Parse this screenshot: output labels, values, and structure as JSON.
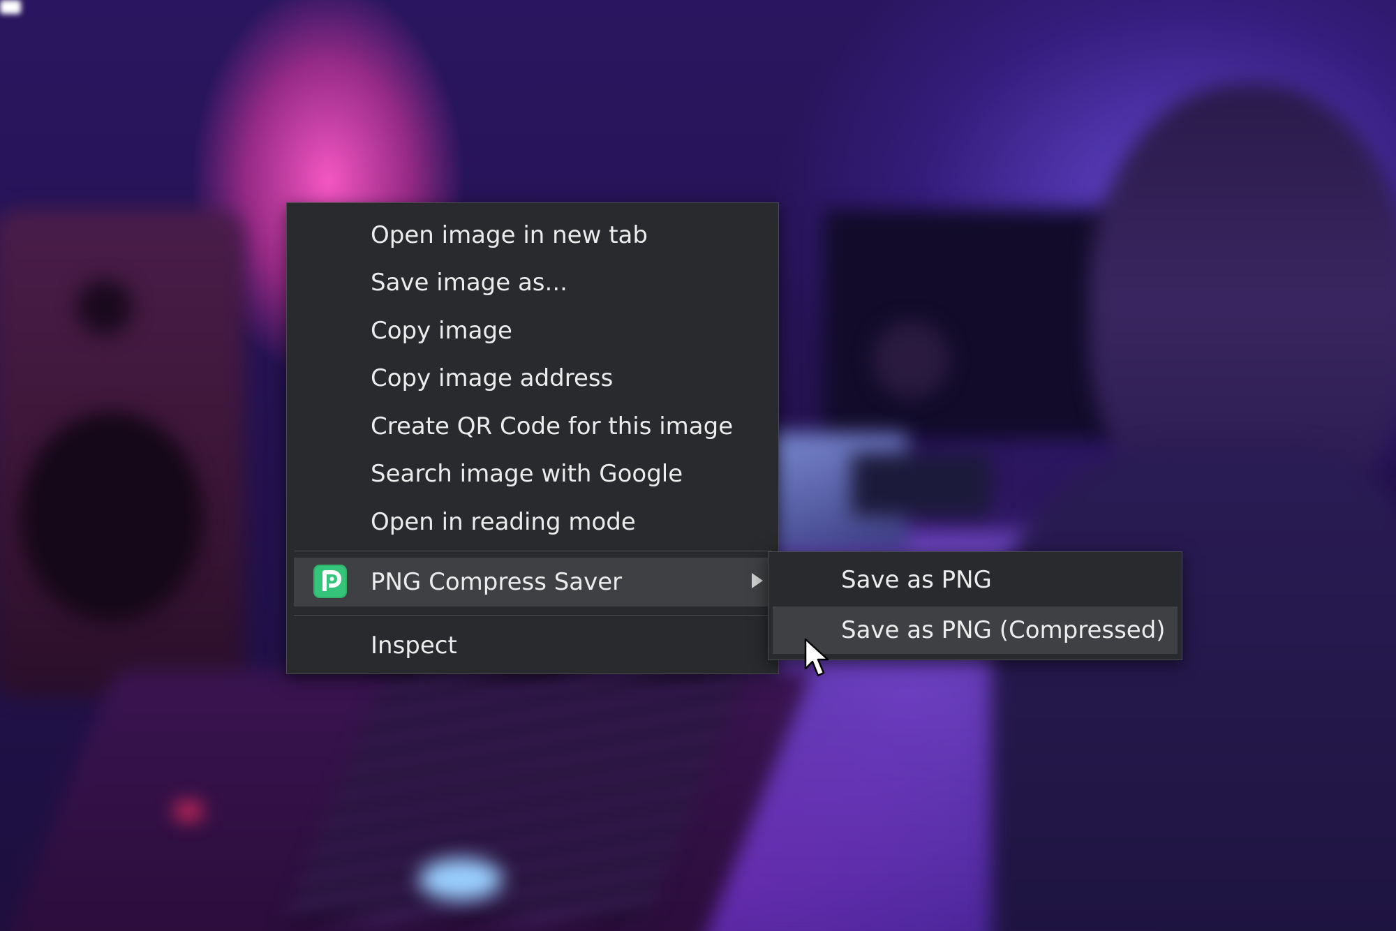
{
  "context_menu": {
    "items": [
      {
        "label": "Open image in new tab"
      },
      {
        "label": "Save image as..."
      },
      {
        "label": "Copy image"
      },
      {
        "label": "Copy image address"
      },
      {
        "label": "Create QR Code for this image"
      },
      {
        "label": "Search image with Google"
      },
      {
        "label": "Open in reading mode"
      }
    ],
    "extension_item": {
      "label": "PNG Compress Saver",
      "icon": "png-compress-saver-icon",
      "icon_letter": "P",
      "icon_color": "#2db36a",
      "has_submenu": true,
      "highlighted": true
    },
    "inspect_label": "Inspect",
    "background_color": "#292a2d",
    "highlight_color": "#3f4043",
    "text_color": "#ececec"
  },
  "submenu": {
    "items": [
      {
        "label": "Save as PNG",
        "highlighted": false
      },
      {
        "label": "Save as PNG (Compressed)",
        "highlighted": true
      }
    ]
  },
  "cursor": {
    "icon": "mouse-pointer-icon",
    "hovering": "submenu.items.1"
  }
}
